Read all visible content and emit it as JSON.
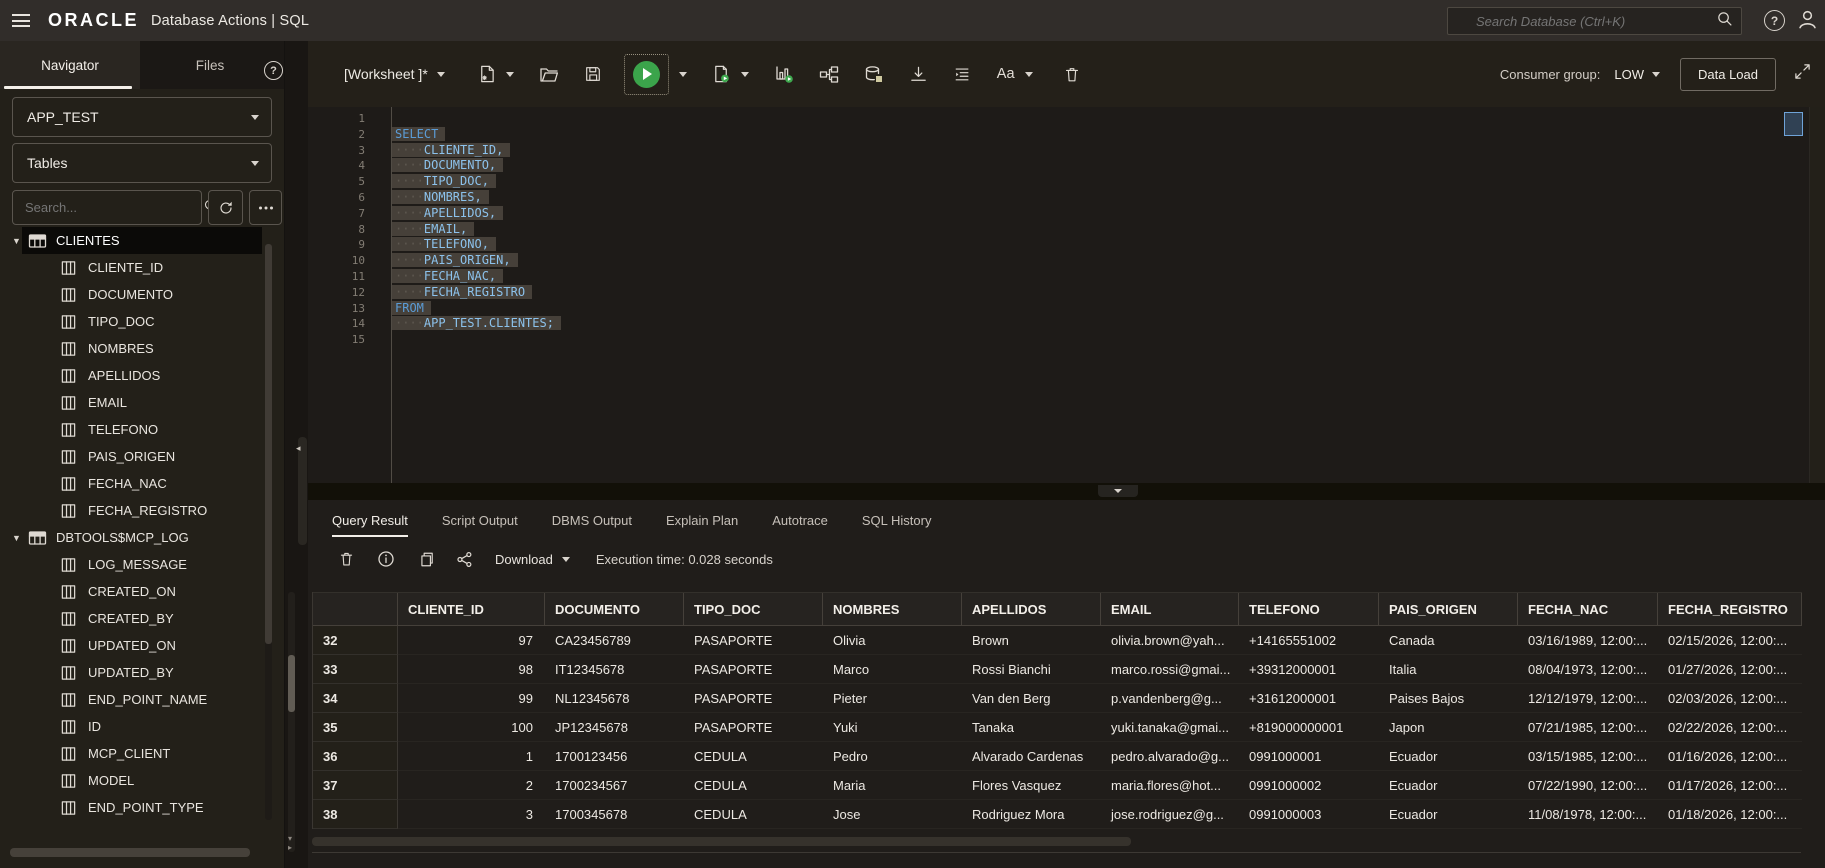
{
  "header": {
    "brand": "ORACLE",
    "product": "Database Actions | SQL",
    "search_placeholder": "Search Database (Ctrl+K)",
    "icons": [
      "menu-icon",
      "search-icon",
      "help-icon",
      "user-icon"
    ]
  },
  "sidebar": {
    "tabs": [
      {
        "label": "Navigator",
        "cls": "active"
      },
      {
        "label": "Files",
        "cls": ""
      }
    ],
    "schema_value": "APP_TEST",
    "object_type_value": "Tables",
    "search_placeholder": "Search...",
    "icons": [
      "help-icon",
      "refresh-icon",
      "more-options-icon",
      "table-icon",
      "column-icon"
    ],
    "tree": [
      {
        "label": "CLIENTES",
        "cls": "table selected"
      },
      {
        "label": "CLIENTE_ID",
        "cls": "column"
      },
      {
        "label": "DOCUMENTO",
        "cls": "column"
      },
      {
        "label": "TIPO_DOC",
        "cls": "column"
      },
      {
        "label": "NOMBRES",
        "cls": "column"
      },
      {
        "label": "APELLIDOS",
        "cls": "column"
      },
      {
        "label": "EMAIL",
        "cls": "column"
      },
      {
        "label": "TELEFONO",
        "cls": "column"
      },
      {
        "label": "PAIS_ORIGEN",
        "cls": "column"
      },
      {
        "label": "FECHA_NAC",
        "cls": "column"
      },
      {
        "label": "FECHA_REGISTRO",
        "cls": "column"
      },
      {
        "label": "DBTOOLS$MCP_LOG",
        "cls": "table"
      },
      {
        "label": "LOG_MESSAGE",
        "cls": "column"
      },
      {
        "label": "CREATED_ON",
        "cls": "column"
      },
      {
        "label": "CREATED_BY",
        "cls": "column"
      },
      {
        "label": "UPDATED_ON",
        "cls": "column"
      },
      {
        "label": "UPDATED_BY",
        "cls": "column"
      },
      {
        "label": "END_POINT_NAME",
        "cls": "column"
      },
      {
        "label": "ID",
        "cls": "column"
      },
      {
        "label": "MCP_CLIENT",
        "cls": "column"
      },
      {
        "label": "MODEL",
        "cls": "column"
      },
      {
        "label": "END_POINT_TYPE",
        "cls": "column"
      }
    ]
  },
  "worksheet": {
    "title": "[Worksheet ]*",
    "font_label": "Aa",
    "consumer_group_label": "Consumer group:",
    "consumer_group_value": "LOW",
    "data_load_label": "Data Load",
    "toolbar_icons": [
      "worksheet-menu-caret",
      "new-worksheet",
      "open-file",
      "save",
      "run-statement",
      "run-script",
      "explain-plan",
      "autotrace",
      "database-tools",
      "download-worksheet",
      "format-sql",
      "font-size",
      "clear-worksheet",
      "expand-editor"
    ]
  },
  "editor": {
    "lines": [
      {
        "n": "1",
        "indent": "",
        "text": "",
        "cls": "",
        "body": ""
      },
      {
        "n": "2",
        "indent": "",
        "text": "SELECT",
        "cls": "kw",
        "body": "sel"
      },
      {
        "n": "3",
        "indent": "····",
        "text": "CLIENTE_ID,",
        "cls": "id",
        "body": "sel"
      },
      {
        "n": "4",
        "indent": "····",
        "text": "DOCUMENTO,",
        "cls": "id",
        "body": "sel"
      },
      {
        "n": "5",
        "indent": "····",
        "text": "TIPO_DOC,",
        "cls": "id",
        "body": "sel"
      },
      {
        "n": "6",
        "indent": "····",
        "text": "NOMBRES,",
        "cls": "id",
        "body": "sel"
      },
      {
        "n": "7",
        "indent": "····",
        "text": "APELLIDOS,",
        "cls": "id",
        "body": "sel"
      },
      {
        "n": "8",
        "indent": "····",
        "text": "EMAIL,",
        "cls": "id",
        "body": "sel"
      },
      {
        "n": "9",
        "indent": "····",
        "text": "TELEFONO,",
        "cls": "id",
        "body": "sel"
      },
      {
        "n": "10",
        "indent": "····",
        "text": "PAIS_ORIGEN,",
        "cls": "id",
        "body": "sel"
      },
      {
        "n": "11",
        "indent": "····",
        "text": "FECHA_NAC,",
        "cls": "id",
        "body": "sel"
      },
      {
        "n": "12",
        "indent": "····",
        "text": "FECHA_REGISTRO",
        "cls": "id",
        "body": "sel"
      },
      {
        "n": "13",
        "indent": "",
        "text": "FROM",
        "cls": "kw",
        "body": "sel"
      },
      {
        "n": "14",
        "indent": "····",
        "text": "APP_TEST.CLIENTES;",
        "cls": "id",
        "body": "sel"
      },
      {
        "n": "15",
        "indent": "",
        "text": "",
        "cls": "",
        "body": ""
      }
    ]
  },
  "results": {
    "tabs": [
      {
        "label": "Query Result",
        "cls": "active"
      },
      {
        "label": "Script Output",
        "cls": ""
      },
      {
        "label": "DBMS Output",
        "cls": ""
      },
      {
        "label": "Explain Plan",
        "cls": ""
      },
      {
        "label": "Autotrace",
        "cls": ""
      },
      {
        "label": "SQL History",
        "cls": ""
      }
    ],
    "toolbar_icons": [
      "clear-output",
      "info",
      "copy-to-clipboard",
      "share"
    ],
    "download_label": "Download",
    "execution_time": "Execution time: 0.028 seconds",
    "grid": {
      "columns": [
        {
          "label": "CLIENTE_ID",
          "cls": "c1"
        },
        {
          "label": "DOCUMENTO",
          "cls": "c2"
        },
        {
          "label": "TIPO_DOC",
          "cls": "c3"
        },
        {
          "label": "NOMBRES",
          "cls": "c4"
        },
        {
          "label": "APELLIDOS",
          "cls": "c5"
        },
        {
          "label": "EMAIL",
          "cls": "c6"
        },
        {
          "label": "TELEFONO",
          "cls": "c7"
        },
        {
          "label": "PAIS_ORIGEN",
          "cls": "c8"
        },
        {
          "label": "FECHA_NAC",
          "cls": "c9"
        },
        {
          "label": "FECHA_REGISTRO",
          "cls": "c10"
        }
      ],
      "rows": [
        {
          "num": "32",
          "id": "97",
          "doc": "CA23456789",
          "tipo": "PASAPORTE",
          "nom": "Olivia",
          "ape": "Brown",
          "email": "olivia.brown@yah...",
          "tel": "+14165551002",
          "pais": "Canada",
          "fnac": "03/16/1989, 12:00:...",
          "freg": "02/15/2026, 12:00:..."
        },
        {
          "num": "33",
          "id": "98",
          "doc": "IT12345678",
          "tipo": "PASAPORTE",
          "nom": "Marco",
          "ape": "Rossi Bianchi",
          "email": "marco.rossi@gmai...",
          "tel": "+39312000001",
          "pais": "Italia",
          "fnac": "08/04/1973, 12:00:...",
          "freg": "01/27/2026, 12:00:..."
        },
        {
          "num": "34",
          "id": "99",
          "doc": "NL12345678",
          "tipo": "PASAPORTE",
          "nom": "Pieter",
          "ape": "Van den Berg",
          "email": "p.vandenberg@g...",
          "tel": "+31612000001",
          "pais": "Paises Bajos",
          "fnac": "12/12/1979, 12:00:...",
          "freg": "02/03/2026, 12:00:..."
        },
        {
          "num": "35",
          "id": "100",
          "doc": "JP12345678",
          "tipo": "PASAPORTE",
          "nom": "Yuki",
          "ape": "Tanaka",
          "email": "yuki.tanaka@gmai...",
          "tel": "+819000000001",
          "pais": "Japon",
          "fnac": "07/21/1985, 12:00:...",
          "freg": "02/22/2026, 12:00:..."
        },
        {
          "num": "36",
          "id": "1",
          "doc": "1700123456",
          "tipo": "CEDULA",
          "nom": "Pedro",
          "ape": "Alvarado Cardenas",
          "email": "pedro.alvarado@g...",
          "tel": "0991000001",
          "pais": "Ecuador",
          "fnac": "03/15/1985, 12:00:...",
          "freg": "01/16/2026, 12:00:..."
        },
        {
          "num": "37",
          "id": "2",
          "doc": "1700234567",
          "tipo": "CEDULA",
          "nom": "Maria",
          "ape": "Flores Vasquez",
          "email": "maria.flores@hot...",
          "tel": "0991000002",
          "pais": "Ecuador",
          "fnac": "07/22/1990, 12:00:...",
          "freg": "01/17/2026, 12:00:..."
        },
        {
          "num": "38",
          "id": "3",
          "doc": "1700345678",
          "tipo": "CEDULA",
          "nom": "Jose",
          "ape": "Rodriguez Mora",
          "email": "jose.rodriguez@g...",
          "tel": "0991000003",
          "pais": "Ecuador",
          "fnac": "11/08/1978, 12:00:...",
          "freg": "01/18/2026, 12:00:..."
        }
      ]
    }
  }
}
